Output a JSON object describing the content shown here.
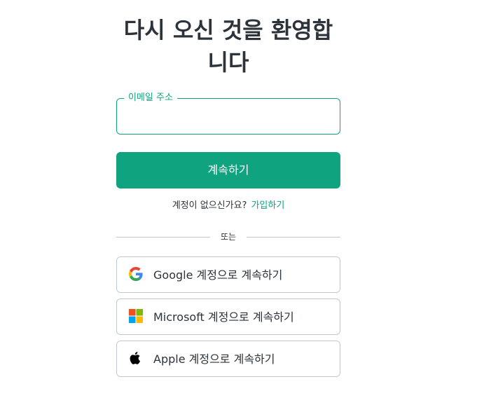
{
  "header": {
    "title": "다시 오신 것을 환영합니다"
  },
  "email": {
    "label": "이메일 주소",
    "value": "",
    "placeholder": ""
  },
  "continue_button": {
    "label": "계속하기"
  },
  "signup": {
    "prompt": "계정이 없으신가요?",
    "link_label": "가입하기"
  },
  "divider": {
    "label": "또는"
  },
  "social": [
    {
      "label": "Google 계정으로 계속하기",
      "icon": "google-icon"
    },
    {
      "label": "Microsoft 계정으로 계속하기",
      "icon": "microsoft-icon"
    },
    {
      "label": "Apple 계정으로 계속하기",
      "icon": "apple-icon"
    }
  ],
  "colors": {
    "accent": "#10a37f",
    "text": "#2d333a",
    "border": "#c2c8d0",
    "google_blue": "#4285F4",
    "google_red": "#EA4335",
    "google_yellow": "#FBBC05",
    "google_green": "#34A853",
    "ms_red": "#F25022",
    "ms_green": "#7FBA00",
    "ms_blue": "#00A4EF",
    "ms_yellow": "#FFB900"
  }
}
